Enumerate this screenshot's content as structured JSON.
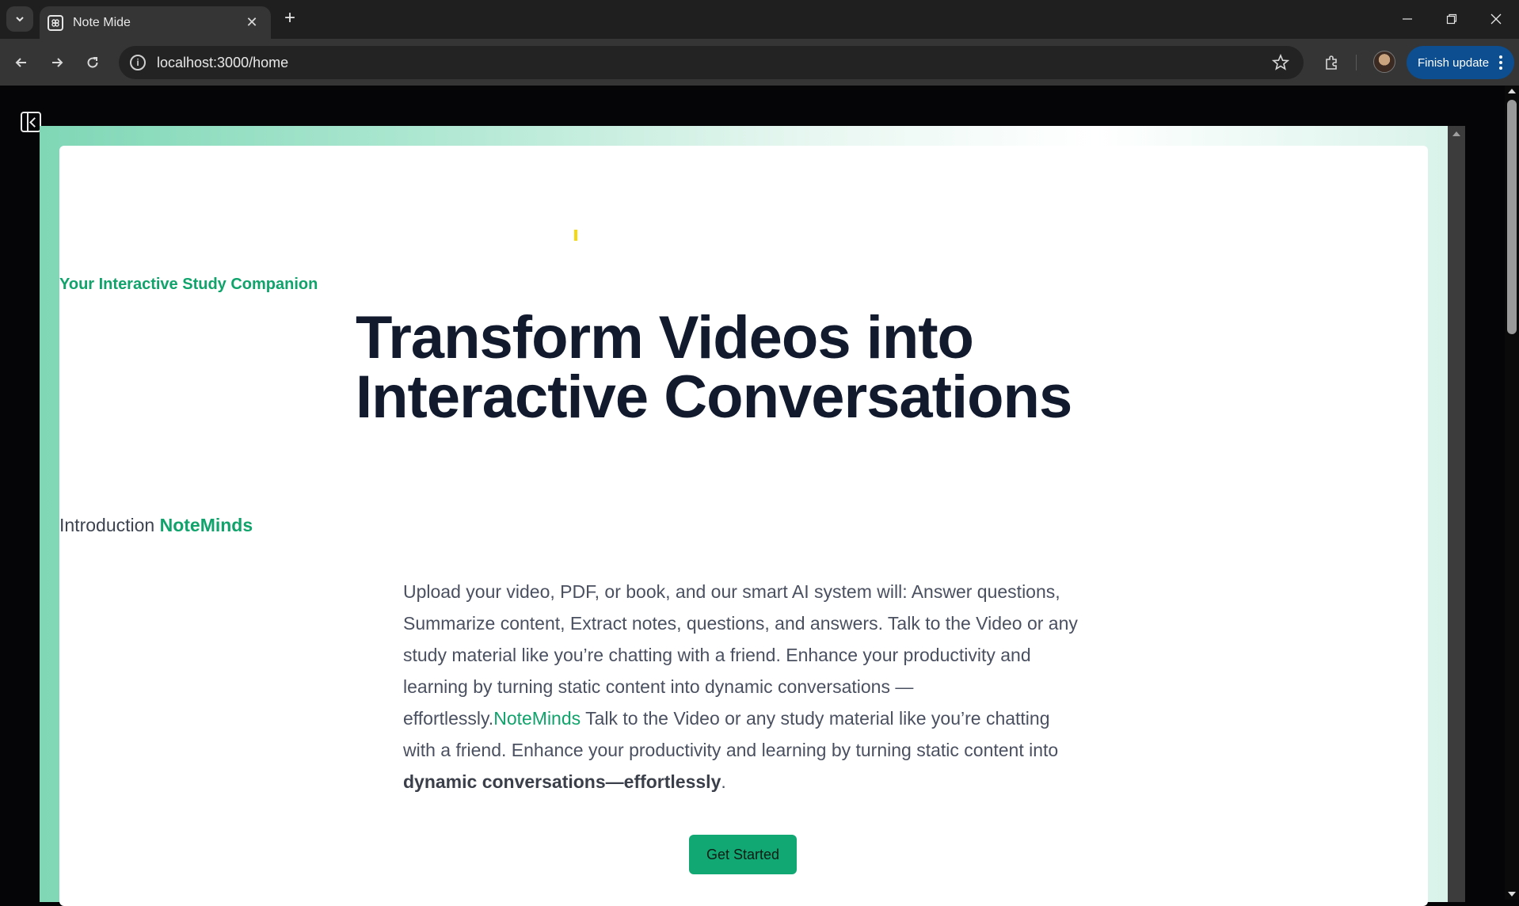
{
  "browser": {
    "tab_title": "Note Mide",
    "url": "localhost:3000/home",
    "update_button_label": "Finish update",
    "icons": {
      "tab_menu": "chevron-down-icon",
      "favicon": "app-favicon-icon",
      "tab_close": "close-icon",
      "new_tab": "plus-icon",
      "back": "arrow-left-icon",
      "forward": "arrow-right-icon",
      "reload": "reload-icon",
      "site_info": "info-icon",
      "bookmark": "star-icon",
      "extensions": "puzzle-icon",
      "profile": "avatar",
      "menu": "more-vertical-icon",
      "minimize": "minimize-icon",
      "restore": "restore-icon",
      "close_window": "close-icon"
    },
    "colors": {
      "update_button": "#0c4e8f"
    }
  },
  "page": {
    "sidebar_toggle_icon": "sidebar-collapse-icon",
    "kicker": "Your Interactive Study Companion",
    "headline": "Transform Videos into Interactive Conversations",
    "intro_prefix": "Introduction",
    "brand_name": "NoteMinds",
    "description_part1": "Upload your video, PDF, or book, and our smart AI system will: Answer questions, Summarize content, Extract notes, questions, and answers. Talk to the Video or any study material like you’re chatting with a friend. Enhance your productivity and learning by turning static content into dynamic conversations —effortlessly.",
    "description_brand": "NoteMinds",
    "description_part2": " Talk to the Video or any study material like you’re chatting with a friend. Enhance your productivity and learning by turning static content into ",
    "description_bold": "dynamic conversations—effortlessly",
    "description_end": ".",
    "cta_label": "Get Started",
    "colors": {
      "accent": "#10a36b",
      "headline": "#121a2e",
      "cta_background": "#12a874"
    }
  }
}
